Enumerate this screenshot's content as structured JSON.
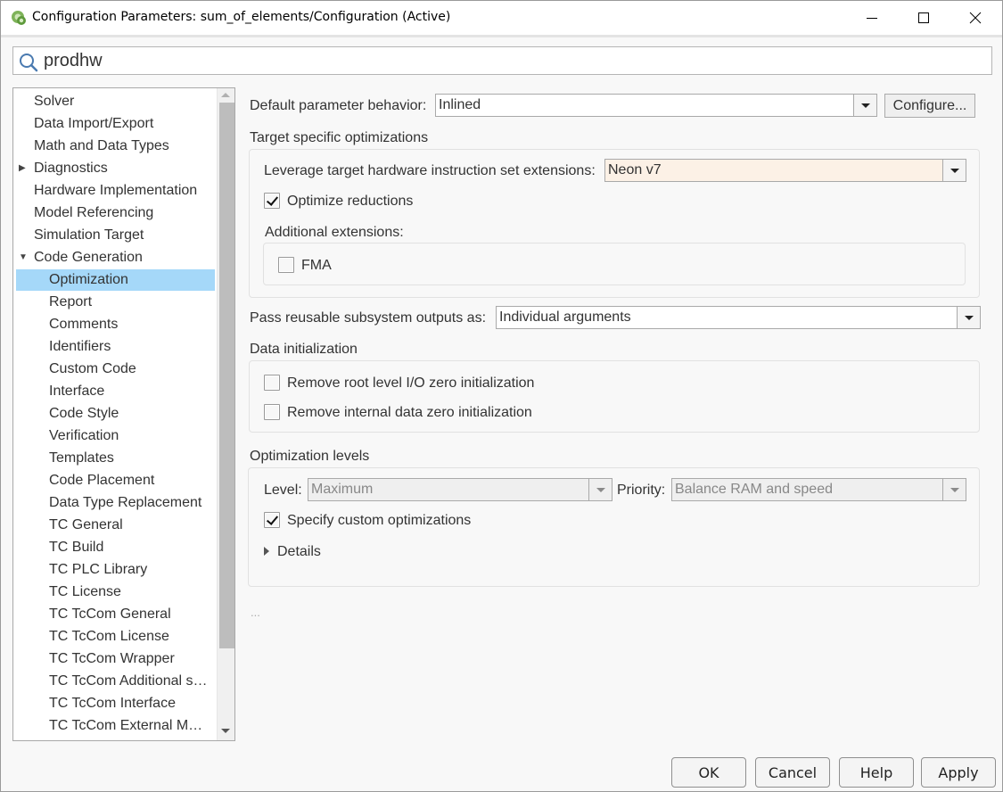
{
  "window": {
    "title": "Configuration Parameters: sum_of_elements/Configuration (Active)",
    "icon": "simulink-config-gear-icon",
    "controls": {
      "minimize": "minimize-icon",
      "maximize": "maximize-icon",
      "close": "close-icon"
    }
  },
  "search": {
    "value": "prodhw",
    "icon": "search-icon"
  },
  "tree": {
    "items": [
      {
        "label": "Solver",
        "level": 0
      },
      {
        "label": "Data Import/Export",
        "level": 0
      },
      {
        "label": "Math and Data Types",
        "level": 0
      },
      {
        "label": "Diagnostics",
        "level": 0,
        "expander": "collapsed"
      },
      {
        "label": "Hardware Implementation",
        "level": 0
      },
      {
        "label": "Model Referencing",
        "level": 0
      },
      {
        "label": "Simulation Target",
        "level": 0
      },
      {
        "label": "Code Generation",
        "level": 0,
        "expander": "expanded"
      },
      {
        "label": "Optimization",
        "level": 1,
        "selected": true
      },
      {
        "label": "Report",
        "level": 1
      },
      {
        "label": "Comments",
        "level": 1
      },
      {
        "label": "Identifiers",
        "level": 1
      },
      {
        "label": "Custom Code",
        "level": 1
      },
      {
        "label": "Interface",
        "level": 1
      },
      {
        "label": "Code Style",
        "level": 1
      },
      {
        "label": "Verification",
        "level": 1
      },
      {
        "label": "Templates",
        "level": 1
      },
      {
        "label": "Code Placement",
        "level": 1
      },
      {
        "label": "Data Type Replacement",
        "level": 1
      },
      {
        "label": "TC General",
        "level": 1
      },
      {
        "label": "TC Build",
        "level": 1
      },
      {
        "label": "TC PLC Library",
        "level": 1
      },
      {
        "label": "TC License",
        "level": 1
      },
      {
        "label": "TC TcCom General",
        "level": 1
      },
      {
        "label": "TC TcCom License",
        "level": 1
      },
      {
        "label": "TC TcCom Wrapper",
        "level": 1
      },
      {
        "label": "TC TcCom Additional s…",
        "level": 1
      },
      {
        "label": "TC TcCom Interface",
        "level": 1
      },
      {
        "label": "TC TcCom External M…",
        "level": 1
      }
    ]
  },
  "main": {
    "default_param": {
      "label": "Default parameter behavior:",
      "value": "Inlined",
      "configure_label": "Configure..."
    },
    "target_specific": {
      "heading": "Target specific optimizations",
      "leverage_label": "Leverage target hardware instruction set extensions:",
      "leverage_value": "Neon v7",
      "optimize_reductions": {
        "label": "Optimize reductions",
        "checked": true
      },
      "additional_heading": "Additional extensions:",
      "fma": {
        "label": "FMA",
        "checked": false
      }
    },
    "pass_reusable": {
      "label": "Pass reusable subsystem outputs as:",
      "value": "Individual arguments"
    },
    "data_init": {
      "heading": "Data initialization",
      "remove_root": {
        "label": "Remove root level I/O zero initialization",
        "checked": false
      },
      "remove_internal": {
        "label": "Remove internal data zero initialization",
        "checked": false
      }
    },
    "opt_levels": {
      "heading": "Optimization levels",
      "level_label": "Level:",
      "level_value": "Maximum",
      "priority_label": "Priority:",
      "priority_value": "Balance RAM and speed",
      "custom": {
        "label": "Specify custom optimizations",
        "checked": true
      },
      "details_label": "Details"
    },
    "ellipsis": "..."
  },
  "footer": {
    "ok": "OK",
    "cancel": "Cancel",
    "help": "Help",
    "apply": "Apply"
  }
}
